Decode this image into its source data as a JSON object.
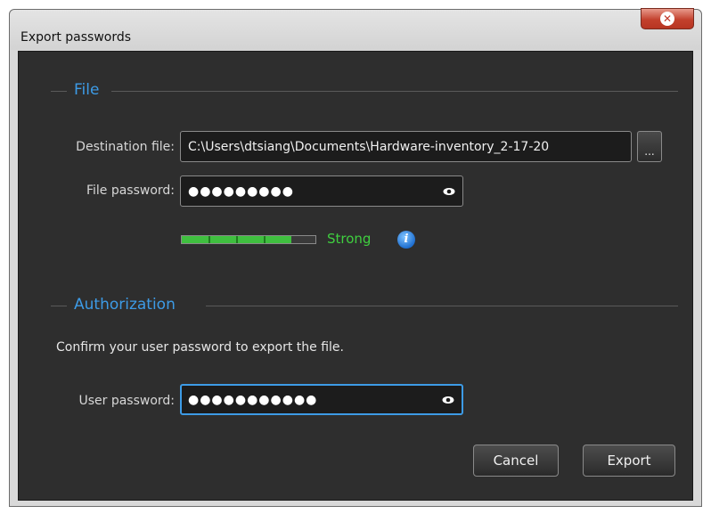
{
  "window": {
    "title": "Export passwords"
  },
  "file_section": {
    "title": "File",
    "destination_label": "Destination file:",
    "destination_value": "C:\\Users\\dtsiang\\Documents\\Hardware-inventory_2-17-20",
    "browse_label": "...",
    "password_label": "File password:",
    "password_value": "●●●●●●●●●",
    "strength": {
      "label": "Strong",
      "level": 0.82,
      "color": "#3fcf3f"
    }
  },
  "authorization_section": {
    "title": "Authorization",
    "instructions": "Confirm your user password to export the file.",
    "password_label": "User password:",
    "password_value": "●●●●●●●●●●●"
  },
  "buttons": {
    "cancel": "Cancel",
    "export": "Export"
  },
  "colors": {
    "accent": "#3d9be6",
    "background": "#2e2e2e",
    "strength_green": "#3fbf3f",
    "close_red": "#c3412d"
  },
  "icons": [
    "close-icon",
    "eye-icon",
    "info-icon"
  ]
}
